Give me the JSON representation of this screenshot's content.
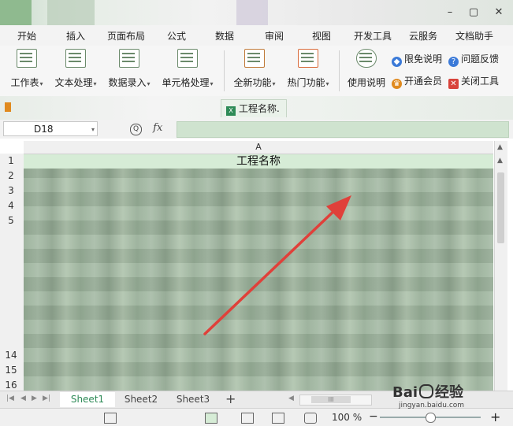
{
  "titlebar": {
    "minimize": "–",
    "maximize": "▢",
    "close": "✕"
  },
  "menu": {
    "tabs": [
      "开始",
      "插入",
      "页面布局",
      "公式",
      "数据",
      "审阅",
      "视图",
      "开发工具",
      "云服务",
      "文档助手"
    ]
  },
  "ribbon": {
    "buttons": [
      {
        "label": "工作表",
        "icon": "worksheet-icon"
      },
      {
        "label": "文本处理",
        "icon": "text-process-icon"
      },
      {
        "label": "数据录入",
        "icon": "data-entry-icon"
      },
      {
        "label": "单元格处理",
        "icon": "cell-process-icon"
      },
      {
        "label": "全新功能",
        "icon": "new-features-icon"
      },
      {
        "label": "热门功能",
        "icon": "hot-features-icon"
      },
      {
        "label": "使用说明",
        "icon": "instructions-icon"
      }
    ],
    "side_items": [
      {
        "label": "限免说明",
        "icon": "tag-icon",
        "color": "#3b7ad8"
      },
      {
        "label": "问题反馈",
        "icon": "question-icon",
        "color": "#3b7ad8"
      },
      {
        "label": "开通会员",
        "icon": "crown-icon",
        "color": "#e08a1e"
      },
      {
        "label": "关闭工具",
        "icon": "close-box-icon",
        "color": "#d8433b"
      }
    ]
  },
  "doc_tab": {
    "title": "工程名称."
  },
  "formula_bar": {
    "cell_ref": "D18",
    "zoom_icon": "Q",
    "fx": "fx",
    "value": ""
  },
  "grid": {
    "column_header": "A",
    "rows": [
      "1",
      "2",
      "3",
      "4",
      "5",
      "14",
      "15",
      "16"
    ],
    "cell_a1": "工程名称"
  },
  "sheets": {
    "tabs": [
      "Sheet1",
      "Sheet2",
      "Sheet3"
    ],
    "active": "Sheet1",
    "add": "+",
    "hscroll_grip": "III"
  },
  "status": {
    "zoom": "100 %",
    "zoom_out": "−",
    "zoom_in": "+",
    "zoom_level": 0.5
  },
  "watermark": {
    "brand": "Bai",
    "brand2": "经验",
    "site": "jingyan.baidu.com"
  },
  "colors": {
    "accent": "#e0403a",
    "selection": "#d6ecd6"
  }
}
